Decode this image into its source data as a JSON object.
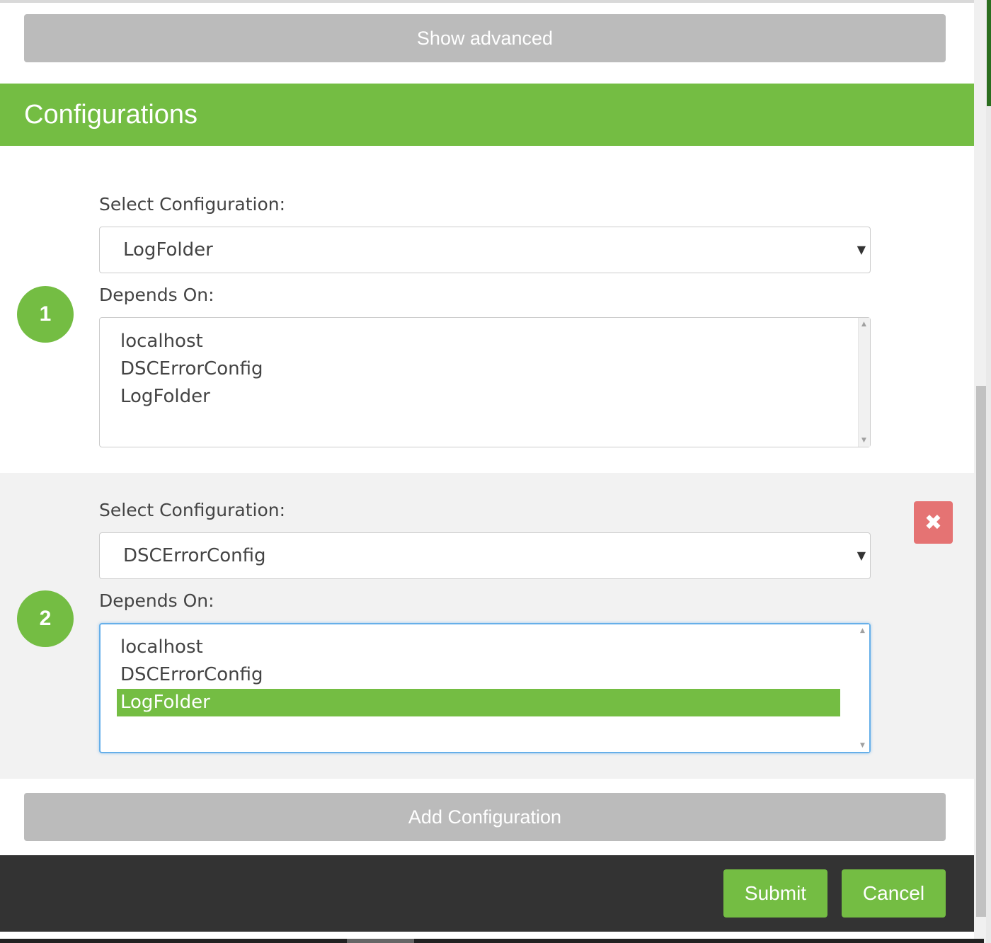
{
  "toolbar": {
    "show_advanced_label": "Show advanced"
  },
  "section": {
    "title": "Configurations"
  },
  "configurations": [
    {
      "number": "1",
      "select_label": "Select Configuration:",
      "selected_value": "LogFolder",
      "depends_label": "Depends On:",
      "options": [
        "localhost",
        "DSCErrorConfig",
        "LogFolder"
      ],
      "selected_option": null
    },
    {
      "number": "2",
      "select_label": "Select Configuration:",
      "selected_value": "DSCErrorConfig",
      "depends_label": "Depends On:",
      "options": [
        "localhost",
        "DSCErrorConfig",
        "LogFolder"
      ],
      "selected_option": "LogFolder"
    }
  ],
  "actions": {
    "add_configuration_label": "Add Configuration",
    "submit_label": "Submit",
    "cancel_label": "Cancel"
  },
  "icons": {
    "dropdown": "caret-down-icon",
    "remove": "close-icon"
  },
  "colors": {
    "accent": "#74bd43",
    "danger": "#e57373",
    "neutral_button": "#bbbbbb",
    "footer": "#333333"
  }
}
